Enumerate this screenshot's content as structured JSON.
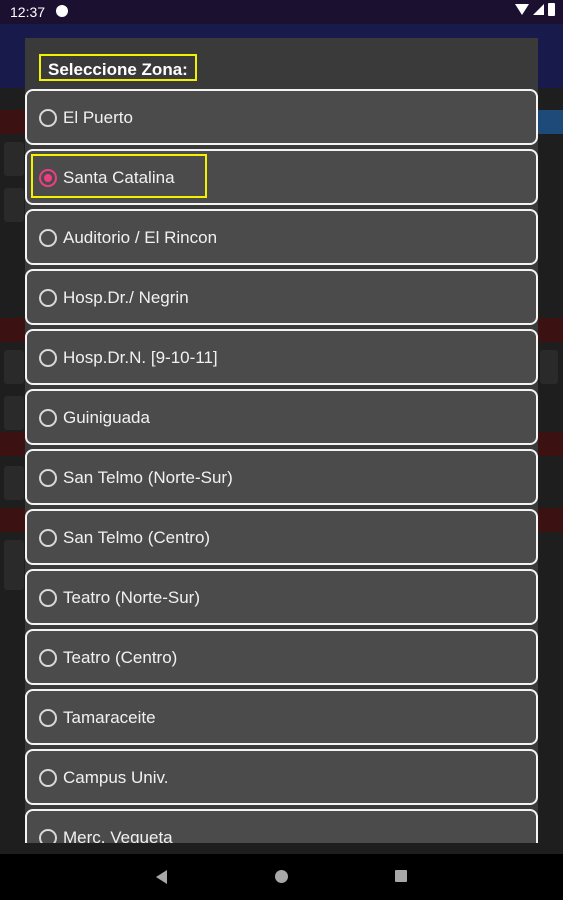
{
  "status_bar": {
    "time": "12:37"
  },
  "dialog": {
    "title": "Seleccione Zona:",
    "selected_zone": "Santa Catalina",
    "zones": [
      {
        "label": "El Puerto",
        "checked": false
      },
      {
        "label": "Santa Catalina",
        "checked": true
      },
      {
        "label": "Auditorio / El Rincon",
        "checked": false
      },
      {
        "label": "Hosp.Dr./ Negrin",
        "checked": false
      },
      {
        "label": "Hosp.Dr.N. [9-10-11]",
        "checked": false
      },
      {
        "label": "Guiniguada",
        "checked": false
      },
      {
        "label": "San Telmo (Norte-Sur)",
        "checked": false
      },
      {
        "label": "San Telmo (Centro)",
        "checked": false
      },
      {
        "label": "Teatro (Norte-Sur)",
        "checked": false
      },
      {
        "label": "Teatro (Centro)",
        "checked": false
      },
      {
        "label": "Tamaraceite",
        "checked": false
      },
      {
        "label": "Campus Univ.",
        "checked": false
      },
      {
        "label": "Merc. Vegueta",
        "checked": false
      }
    ]
  },
  "colors": {
    "accent": "#ee3e82",
    "highlight": "#f2f200",
    "band_red": "#6a1010",
    "band_blue": "#1e5f9e"
  },
  "icons": {
    "status": [
      "app-notification-icon",
      "wifi-icon",
      "signal-icon",
      "battery-icon"
    ],
    "nav": [
      "back-icon",
      "home-icon",
      "recents-icon"
    ]
  }
}
